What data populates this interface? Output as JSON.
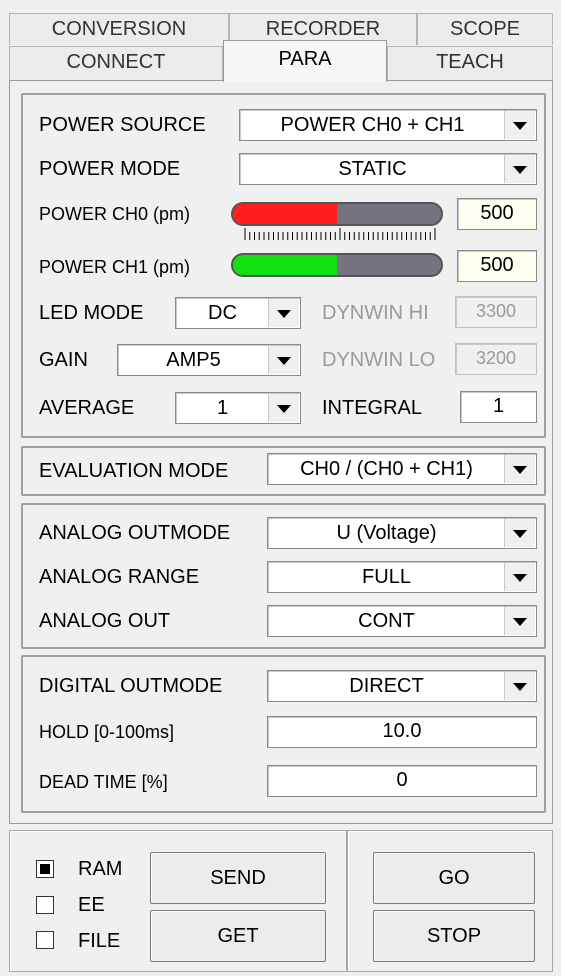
{
  "tabs": {
    "row1": [
      "CONVERSION",
      "RECORDER",
      "SCOPE"
    ],
    "row2": [
      "CONNECT",
      "PARA",
      "TEACH"
    ],
    "active": "PARA"
  },
  "power": {
    "source_label": "POWER SOURCE",
    "source_value": "POWER CH0 + CH1",
    "mode_label": "POWER MODE",
    "mode_value": "STATIC",
    "ch0_label": "POWER CH0 (pm)",
    "ch0_value": "500",
    "ch0_level": 0.5,
    "ch0_color": "#ff1f1f",
    "ch1_label": "POWER CH1 (pm)",
    "ch1_value": "500",
    "ch1_level": 0.5,
    "ch1_color": "#11e011",
    "led_mode_label": "LED MODE",
    "led_mode_value": "DC",
    "dynwin_hi_label": "DYNWIN HI",
    "dynwin_hi_value": "3300",
    "gain_label": "GAIN",
    "gain_value": "AMP5",
    "dynwin_lo_label": "DYNWIN LO",
    "dynwin_lo_value": "3200",
    "average_label": "AVERAGE",
    "average_value": "1",
    "integral_label": "INTEGRAL",
    "integral_value": "1"
  },
  "evaluation": {
    "mode_label": "EVALUATION MODE",
    "mode_value": "CH0 / (CH0 + CH1)"
  },
  "analog": {
    "outmode_label": "ANALOG OUTMODE",
    "outmode_value": "U (Voltage)",
    "range_label": "ANALOG RANGE",
    "range_value": "FULL",
    "out_label": "ANALOG OUT",
    "out_value": "CONT"
  },
  "digital": {
    "outmode_label": "DIGITAL OUTMODE",
    "outmode_value": "DIRECT",
    "hold_label": "HOLD [0-100ms]",
    "hold_value": "10.0",
    "dead_label": "DEAD TIME [%]",
    "dead_value": "0"
  },
  "memory": {
    "ram": "RAM",
    "ee": "EE",
    "file": "FILE",
    "ram_checked": true,
    "ee_checked": false,
    "file_checked": false
  },
  "buttons": {
    "send": "SEND",
    "get": "GET",
    "go": "GO",
    "stop": "STOP"
  }
}
